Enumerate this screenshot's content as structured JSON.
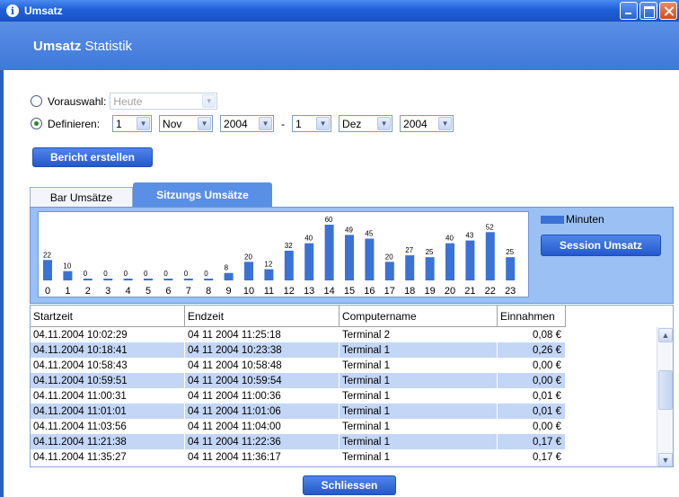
{
  "window": {
    "title": "Umsatz",
    "icon": "info-icon"
  },
  "header": {
    "bold": "Umsatz",
    "rest": " Statistik"
  },
  "filter": {
    "preset_label": "Vorauswahl:",
    "preset_value": "Heute",
    "define_label": "Definieren:",
    "from_day": "1",
    "from_month": "Nov",
    "from_year": "2004",
    "separator": "-",
    "to_day": "1",
    "to_month": "Dez",
    "to_year": "2004",
    "selected": "define"
  },
  "actions": {
    "create_report": "Bericht erstellen",
    "close": "Schliessen",
    "session_revenue": "Session Umsatz"
  },
  "tabs": [
    {
      "label": "Bar Umsätze",
      "active": false
    },
    {
      "label": "Sitzungs Umsätze",
      "active": true
    }
  ],
  "chart_data": {
    "type": "bar",
    "categories": [
      "0",
      "1",
      "2",
      "3",
      "4",
      "5",
      "6",
      "7",
      "8",
      "9",
      "10",
      "11",
      "12",
      "13",
      "14",
      "15",
      "16",
      "17",
      "18",
      "19",
      "20",
      "21",
      "22",
      "23"
    ],
    "series": [
      {
        "name": "Minuten",
        "values": [
          22,
          10,
          0,
          0,
          0,
          0,
          0,
          0,
          0,
          8,
          20,
          12,
          32,
          40,
          60,
          49,
          45,
          20,
          27,
          25,
          40,
          43,
          52,
          25
        ]
      }
    ],
    "ylim": [
      0,
      60
    ],
    "color": "#3a72d6",
    "legend": "top-right"
  },
  "table": {
    "columns": [
      "Startzeit",
      "Endzeit",
      "Computername",
      "Einnahmen"
    ],
    "rows": [
      [
        "04.11.2004 10:02:29",
        "04 11 2004 11:25:18",
        "Terminal 2",
        "0,08 €"
      ],
      [
        "04.11.2004 10:18:41",
        "04 11 2004 10:23:38",
        "Terminal 1",
        "0,26 €"
      ],
      [
        "04.11.2004 10:58:43",
        "04 11 2004 10:58:48",
        "Terminal 1",
        "0,00 €"
      ],
      [
        "04.11.2004 10:59:51",
        "04 11 2004 10:59:54",
        "Terminal 1",
        "0,00 €"
      ],
      [
        "04.11.2004 11:00:31",
        "04 11 2004 11:00:36",
        "Terminal 1",
        "0,01 €"
      ],
      [
        "04.11.2004 11:01:01",
        "04 11 2004 11:01:06",
        "Terminal 1",
        "0,01 €"
      ],
      [
        "04.11.2004 11:03:56",
        "04 11 2004 11:04:00",
        "Terminal 1",
        "0,00 €"
      ],
      [
        "04.11.2004 11:21:38",
        "04 11 2004 11:22:36",
        "Terminal 1",
        "0,17 €"
      ],
      [
        "04.11.2004 11:35:27",
        "04 11 2004 11:36:17",
        "Terminal 1",
        "0,17 €"
      ]
    ]
  }
}
